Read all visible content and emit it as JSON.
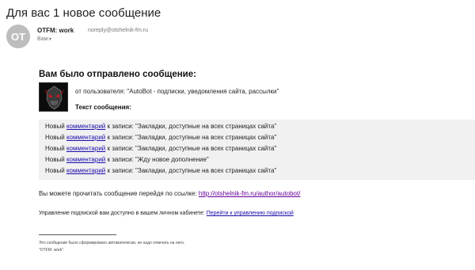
{
  "email": {
    "subject": "Для вас 1 новое сообщение",
    "sender": {
      "avatar_initials": "OT",
      "name": "OTFM: work",
      "address": "noreply@otshelnik-fm.ru",
      "to_label": "Вам:",
      "to_caret": "▾"
    },
    "heading": "Вам было отправлено сообщение:",
    "bot_avatar_icon": "robot-logo-icon",
    "from_line": "от пользователя: \"AutoBot - подписки, уведомления сайта, рассылки\"",
    "message_title": "Текст сообщения:",
    "messages": [
      {
        "prefix": "Новый",
        "link": "комментарий",
        "suffix": "к записи: \"Закладки, доступные на всех страницах сайта\""
      },
      {
        "prefix": "Новый",
        "link": "комментарий",
        "suffix": "к записи: \"Закладки, доступные на всех страницах сайта\""
      },
      {
        "prefix": "Новый",
        "link": "комментарий",
        "suffix": "к записи: \"Закладки, доступные на всех страницах сайта\""
      },
      {
        "prefix": "Новый",
        "link": "комментарий",
        "suffix": "к записи: \"Жду новое дополнение\""
      },
      {
        "prefix": "Новый",
        "link": "комментарий",
        "suffix": "к записи: \"Закладки, доступные на всех страницах сайта\""
      }
    ],
    "read_text": "Вы можете прочитать сообщение перейдя по ссылке:",
    "read_link": "http://otshelnik-fm.ru/author/autobot/",
    "manage_text": "Управление подпиской вам доступно в вашем личном кабинете:",
    "manage_link": "Перейти к управлению подпиской",
    "footer_note": "Это сообщение было сформировано автоматически, не надо отвечать на него.",
    "footer_sign": "\"OTFM: work\"."
  },
  "colors": {
    "link": "#1a0dab",
    "visited_link": "#660099",
    "message_box_bg": "#f1f1f1",
    "avatar_bg": "#bdbdbd"
  }
}
